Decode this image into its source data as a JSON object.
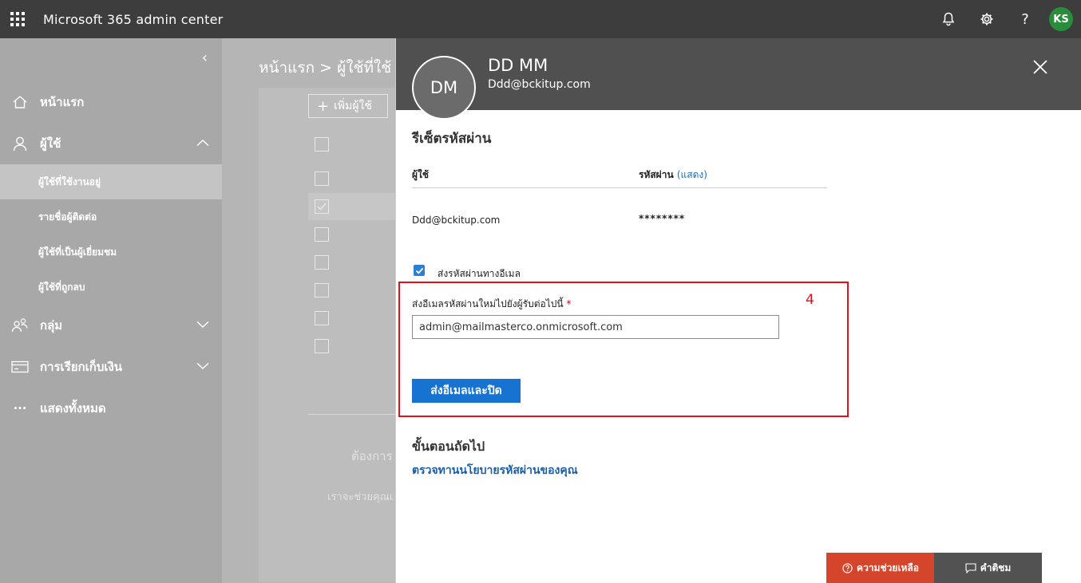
{
  "app": {
    "title": "Microsoft 365 admin center",
    "user_initials": "KS",
    "icons": [
      "waffle-icon",
      "bell-icon",
      "gear-icon",
      "help-icon"
    ],
    "help_glyph": "?"
  },
  "sidebar": {
    "collapse_glyph": "‹",
    "items": [
      {
        "label": "หน้าแรก",
        "icon": "home-icon"
      },
      {
        "label": "ผู้ใช้",
        "icon": "person-icon",
        "expanded": true
      },
      {
        "label": "กลุ่ม",
        "icon": "group-icon"
      },
      {
        "label": "การเรียกเก็บเงิน",
        "icon": "billing-icon"
      },
      {
        "label": "แสดงทั้งหมด",
        "icon": "ellipsis-icon"
      }
    ],
    "sub_items": [
      "ผู้ใช้ที่ใช้งานอยู่",
      "รายชื่อผู้ติดต่อ",
      "ผู้ใช้ที่เป็นผู้เยี่ยมชม",
      "ผู้ใช้ที่ถูกลบ"
    ],
    "ellipsis_glyph": "···"
  },
  "main": {
    "breadcrumb": "หน้าแรก > ผู้ใช้ที่ใช้",
    "add_user_label": "เพิ่มผู้ใช้",
    "add_glyph": "+",
    "faint_text_1": "ต้องการ",
    "faint_text_2": "เราจะช่วยคุณเ"
  },
  "panel": {
    "avatar_initials": "DM",
    "user_name": "DD MM",
    "user_email": "Ddd@bckitup.com",
    "section_title": "รีเซ็ตรหัสผ่าน",
    "col_user": "ผู้ใช้",
    "col_password": "รหัสผ่าน",
    "show_link": "(แสดง)",
    "row_user": "Ddd@bckitup.com",
    "row_password": "********",
    "checkbox_label": "ส่งรหัสผ่านทางอีเมล",
    "checkbox_checked": true,
    "field_label": "ส่งอีเมลรหัสผ่านใหม่ไปยังผู้รับต่อไปนี้",
    "required_mark": "*",
    "email_value": "admin@mailmasterco.onmicrosoft.com",
    "send_button": "ส่งอีเมลและปิด",
    "annotation_number": "4",
    "next_steps_title": "ขั้นตอนถัดไป",
    "next_steps_link": "ตรวจทานนโยบายรหัสผ่านของคุณ",
    "help_button": "ความช่วยเหลือ",
    "feedback_button": "คำติชม"
  },
  "colors": {
    "topbar": "#3d3d3d",
    "accent_blue": "#1673d1",
    "highlight_red": "#e0101e",
    "help_red": "#d5452b",
    "avatar_green": "#2a8d3c"
  }
}
